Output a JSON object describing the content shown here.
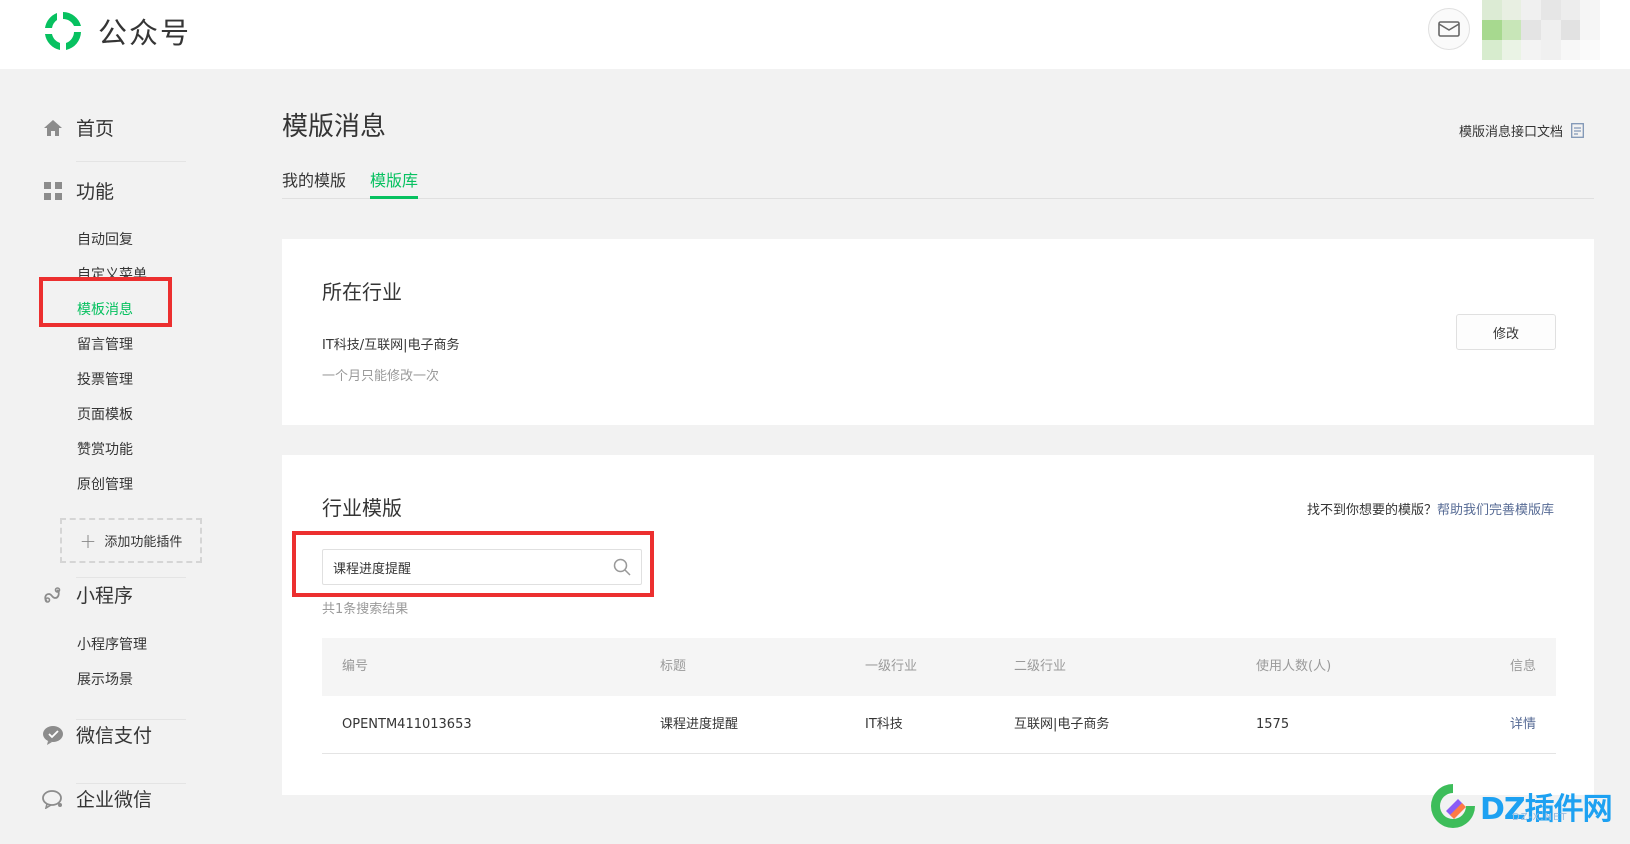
{
  "header": {
    "app_title": "公众号",
    "mail_icon": "mail-icon"
  },
  "sidebar": {
    "home": "首页",
    "functions": "功能",
    "function_items": [
      "自动回复",
      "自定义菜单",
      "模板消息",
      "留言管理",
      "投票管理",
      "页面模板",
      "赞赏功能",
      "原创管理"
    ],
    "active_item": "模板消息",
    "add_plugin": "添加功能插件",
    "miniprogram": "小程序",
    "miniprogram_items": [
      "小程序管理",
      "展示场景"
    ],
    "wechat_pay": "微信支付",
    "enterprise_wechat": "企业微信"
  },
  "main": {
    "page_title": "模版消息",
    "doc_link": "模版消息接口文档",
    "tabs": [
      "我的模版",
      "模版库"
    ],
    "active_tab": "模版库",
    "industry": {
      "title": "所在行业",
      "value": "IT科技/互联网|电子商务",
      "hint": "一个月只能修改一次",
      "modify_button": "修改"
    },
    "templates": {
      "title": "行业模版",
      "help_prefix": "找不到你想要的模版？",
      "help_link": "帮助我们完善模版库",
      "search_value": "课程进度提醒",
      "result_count": "共1条搜索结果",
      "columns": [
        "编号",
        "标题",
        "一级行业",
        "二级行业",
        "使用人数(人)",
        "信息"
      ],
      "rows": [
        {
          "id": "OPENTM411013653",
          "title": "课程进度提醒",
          "industry1": "IT科技",
          "industry2": "互联网|电子商务",
          "users": "1575",
          "info": "详情"
        }
      ]
    }
  },
  "watermark": {
    "text": "DZ插件网",
    "sub": "DZ-X.NET"
  },
  "colors": {
    "brand_green": "#07c160",
    "link_blue": "#576b95",
    "highlight_red": "#ec2f2f"
  }
}
